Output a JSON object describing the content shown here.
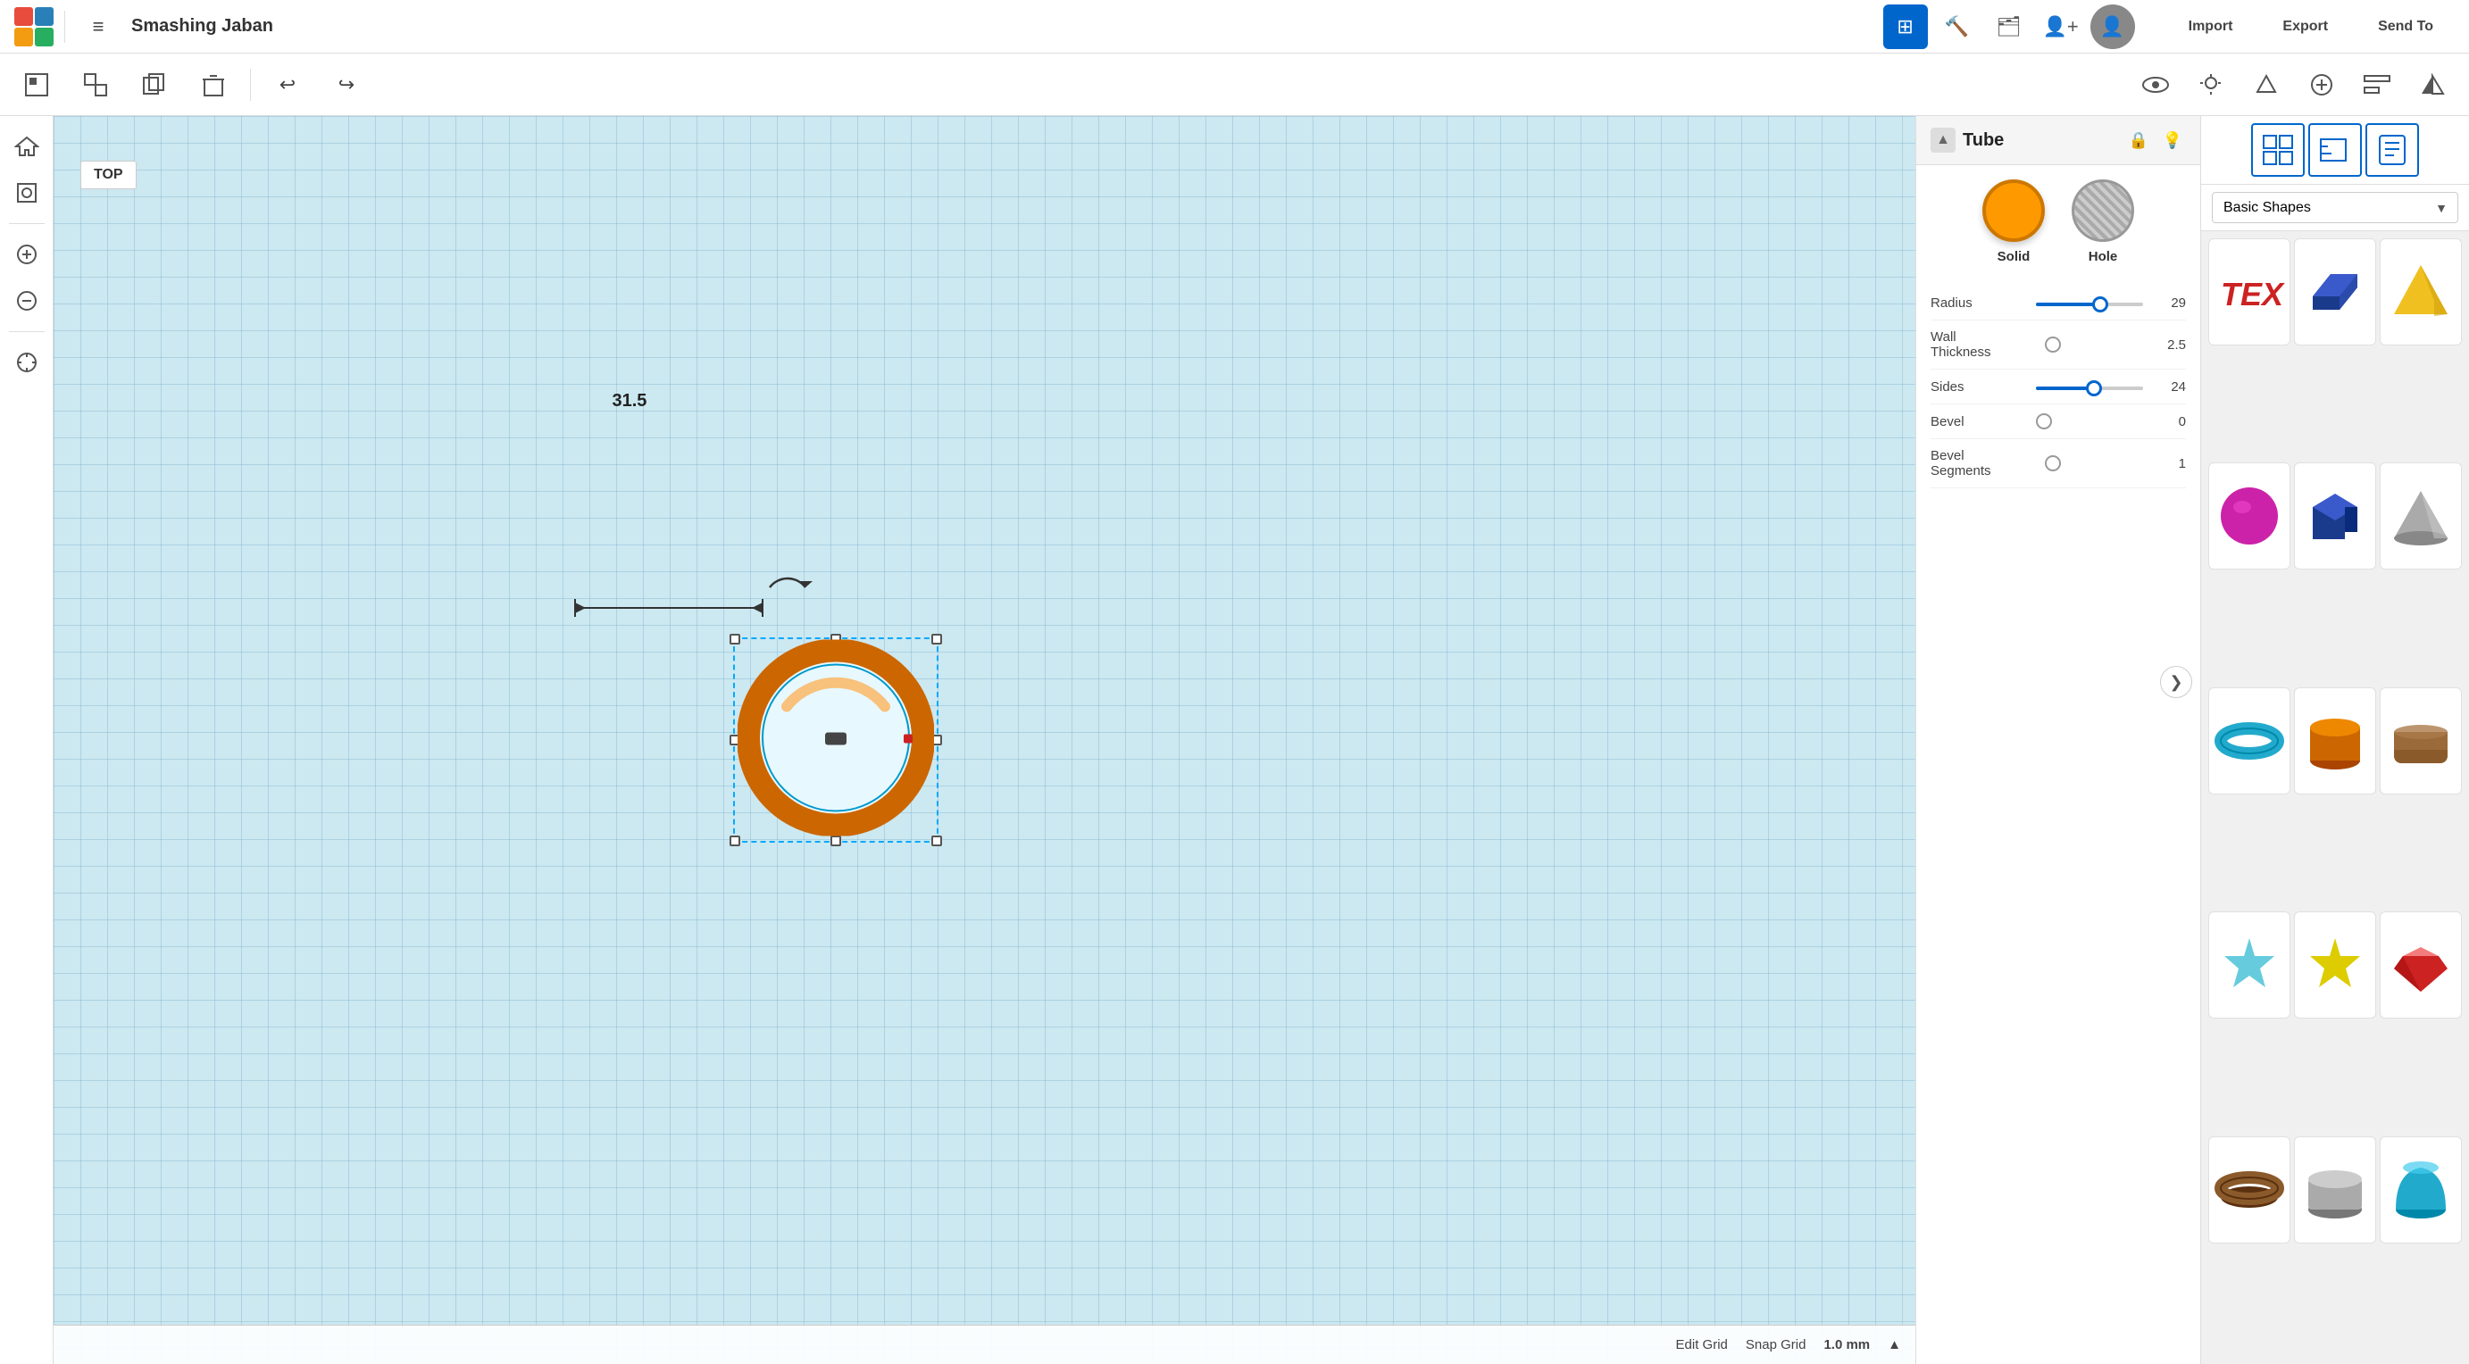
{
  "app": {
    "title": "Smashing Jaban"
  },
  "topbar": {
    "logo_colors": [
      "#e74c3c",
      "#2980b9",
      "#f39c12",
      "#27ae60"
    ],
    "grid_icon": "⊞",
    "hammer_icon": "🔨",
    "briefcase_icon": "💼",
    "user_icon": "👤",
    "avatar_icon": "👤",
    "import_label": "Import",
    "export_label": "Export",
    "send_to_label": "Send To"
  },
  "toolbar": {
    "group_icon": "□",
    "ungroup_icon": "⧉",
    "duplicate_icon": "⧈",
    "delete_icon": "🗑",
    "undo_icon": "↩",
    "redo_icon": "↪",
    "view_icons": [
      "👁",
      "💡",
      "⬡",
      "⊕",
      "⊻",
      "△"
    ]
  },
  "view_label": "TOP",
  "canvas": {
    "dimension_label": "31.5",
    "snap_grid_label": "Snap Grid",
    "snap_grid_value": "1.0 mm",
    "edit_grid_label": "Edit Grid"
  },
  "panel": {
    "title": "Tube",
    "solid_label": "Solid",
    "hole_label": "Hole",
    "props": [
      {
        "label": "Radius",
        "value": "29",
        "has_slider": true,
        "slider_val": 0.62
      },
      {
        "label": "Wall Thickness",
        "value": "2.5",
        "has_slider": false,
        "slider_val": 0
      },
      {
        "label": "Sides",
        "value": "24",
        "has_slider": true,
        "slider_val": 0.55
      },
      {
        "label": "Bevel",
        "value": "0",
        "has_slider": false,
        "slider_val": 0
      },
      {
        "label": "Bevel Segments",
        "value": "1",
        "has_slider": false,
        "slider_val": 0
      }
    ]
  },
  "shapes_panel": {
    "dropdown_label": "Basic Shapes",
    "shapes": [
      {
        "name": "text-shape",
        "color": "#cc2222",
        "type": "text"
      },
      {
        "name": "box-shape",
        "color": "#1a3a8c",
        "type": "box"
      },
      {
        "name": "pyramid-shape",
        "color": "#f0c020",
        "type": "pyramid"
      },
      {
        "name": "sphere-shape",
        "color": "#cc22aa",
        "type": "sphere"
      },
      {
        "name": "cube-shape",
        "color": "#1a3a8c",
        "type": "cube"
      },
      {
        "name": "cone-shape",
        "color": "#aaaaaa",
        "type": "cone"
      },
      {
        "name": "torus-shape",
        "color": "#22aacc",
        "type": "torus"
      },
      {
        "name": "cylinder-shape",
        "color": "#cc6600",
        "type": "cylinder"
      },
      {
        "name": "wedge-shape",
        "color": "#8B5A2B",
        "type": "wedge"
      },
      {
        "name": "star-shape",
        "color": "#66ccdd",
        "type": "star"
      },
      {
        "name": "star2-shape",
        "color": "#ddcc00",
        "type": "star2"
      },
      {
        "name": "gem-shape",
        "color": "#cc2222",
        "type": "gem"
      },
      {
        "name": "ring-shape",
        "color": "#8B5A2B",
        "type": "ring"
      },
      {
        "name": "round-cylinder-shape",
        "color": "#aaaaaa",
        "type": "round-cylinder"
      },
      {
        "name": "paraboloid-shape",
        "color": "#22aacc",
        "type": "paraboloid"
      }
    ]
  }
}
